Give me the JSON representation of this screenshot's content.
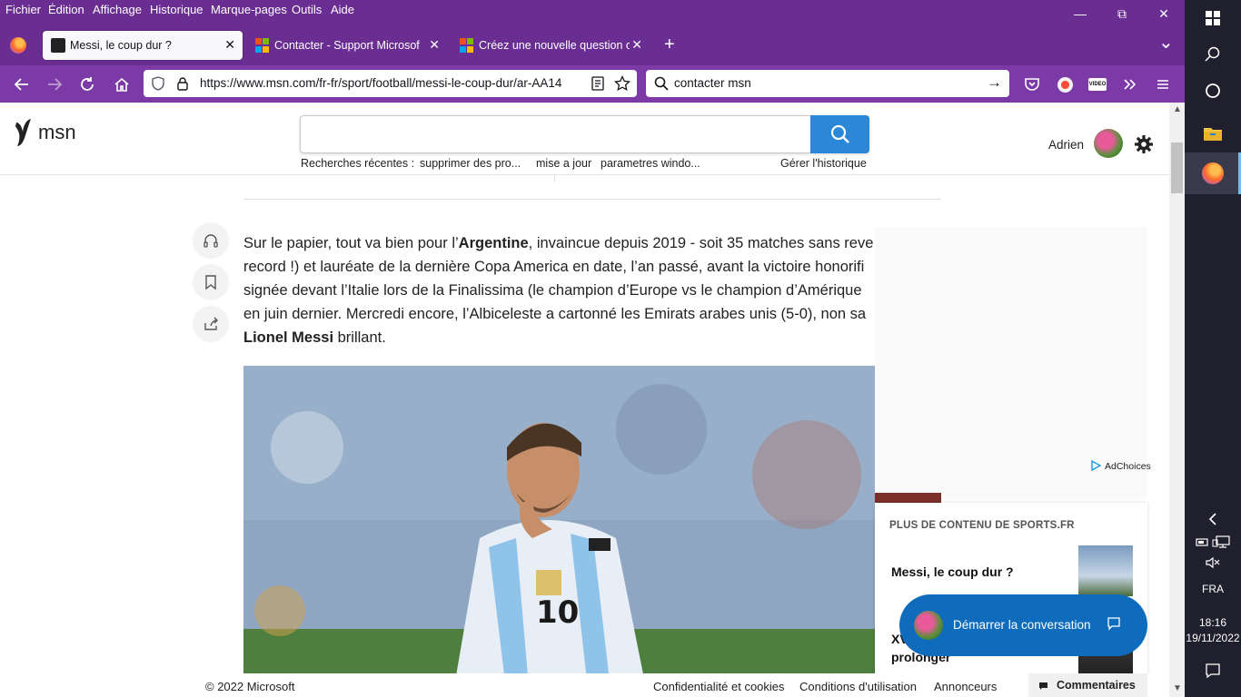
{
  "menubar": {
    "items": [
      {
        "label": "Fichier"
      },
      {
        "label": "Édition"
      },
      {
        "label": "Affichage"
      },
      {
        "label": "Historique"
      },
      {
        "label": "Marque-pages"
      },
      {
        "label": "Outils"
      },
      {
        "label": "Aide"
      }
    ]
  },
  "window": {
    "minimize": "—",
    "restore": "⧉",
    "close": "✕"
  },
  "tabs": [
    {
      "title": "Messi, le coup dur ?",
      "close": "✕"
    },
    {
      "title": "Contacter - Support Microsoft",
      "close": "✕"
    },
    {
      "title": "Créez une nouvelle question ou",
      "close": "✕"
    }
  ],
  "new_tab": "+",
  "tab_list": "⌄",
  "navbar": {
    "url": "https://www.msn.com/fr-fr/sport/football/messi-le-coup-dur/ar-AA14",
    "search_query": "contacter msn",
    "go": "→"
  },
  "msn": {
    "logo_text": "msn",
    "search_placeholder": "",
    "recent_label": "Recherches récentes :",
    "recent_items": [
      "supprimer des pro...",
      "mise a jour",
      "parametres windo..."
    ],
    "manage_history": "Gérer l'historique",
    "user_name": "Adrien"
  },
  "article": {
    "lines": [
      [
        "Sur le papier, tout va bien pour l’",
        "Argentine",
        ", invaincue depuis 2019 - soit 35 matches sans reve"
      ],
      [
        "record !) et lauréate de la dernière Copa America en date, l’an passé, avant la victoire honorifi"
      ],
      [
        "signée devant l’Italie lors de la Finalissima (le champion d’Europe vs le champion d’Amérique"
      ],
      [
        "en juin dernier. Mercredi encore, l’Albiceleste a cartonné les Emirats arabes unis (5-0), non sa"
      ],
      [
        "Lionel Messi",
        " brillant."
      ]
    ]
  },
  "sidebar": {
    "adchoices": "AdChoices",
    "more_title": "PLUS DE CONTENU DE SPORTS.FR",
    "item1": "Messi, le coup dur ?",
    "item2_line1": "XV",
    "item2_line2": "prolonger"
  },
  "chat": {
    "label": "Démarrer la conversation"
  },
  "footer": {
    "copyright": "© 2022 Microsoft",
    "privacy": "Confidentialité et cookies",
    "terms": "Conditions d'utilisation",
    "advertisers": "Annonceurs",
    "comments": "Commentaires"
  },
  "taskbar": {
    "language": "FRA",
    "time": "18:16",
    "date": "19/11/2022"
  },
  "colors": {
    "firefox_purple": "#6a2d91",
    "msn_blue": "#2b88d8",
    "chat_blue": "#0f6cbd",
    "taskbar": "#1f1f2e"
  }
}
